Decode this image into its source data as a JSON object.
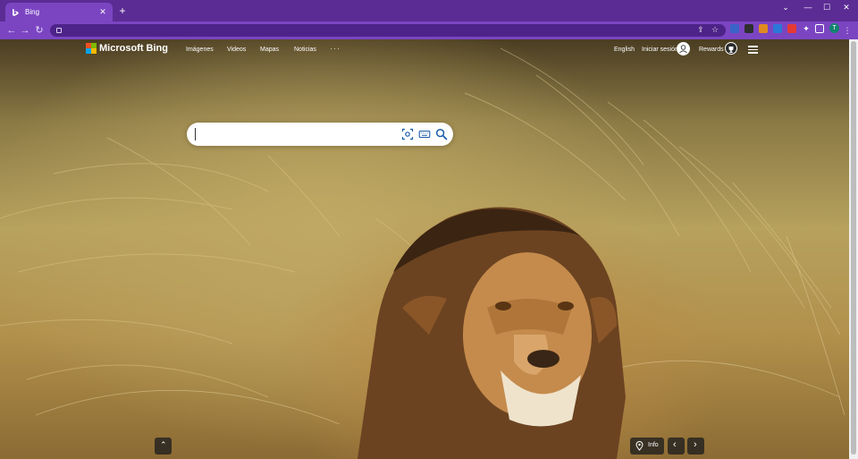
{
  "browser": {
    "tab_title": "Bing",
    "tab_close": "✕",
    "new_tab": "+",
    "window_controls": [
      "⌄",
      "—",
      "☐",
      "✕"
    ],
    "nav_back": "←",
    "nav_forward": "→",
    "nav_reload": "↻",
    "omnibox_value": "",
    "profile_initial": "T",
    "menu_glyph": "⋮",
    "theme_color": "#7b45c2"
  },
  "bing": {
    "logo_text": "Microsoft Bing",
    "nav": [
      "Imágenes",
      "Videos",
      "Mapas",
      "Noticias"
    ],
    "more_glyph": "···",
    "language_link": "English",
    "sign_in": "Iniciar sesión",
    "rewards": "Rewards",
    "search_value": "",
    "info_button": "Info",
    "prev_glyph": "‹",
    "next_glyph": "›",
    "scroll_up_glyph": "⌃"
  }
}
